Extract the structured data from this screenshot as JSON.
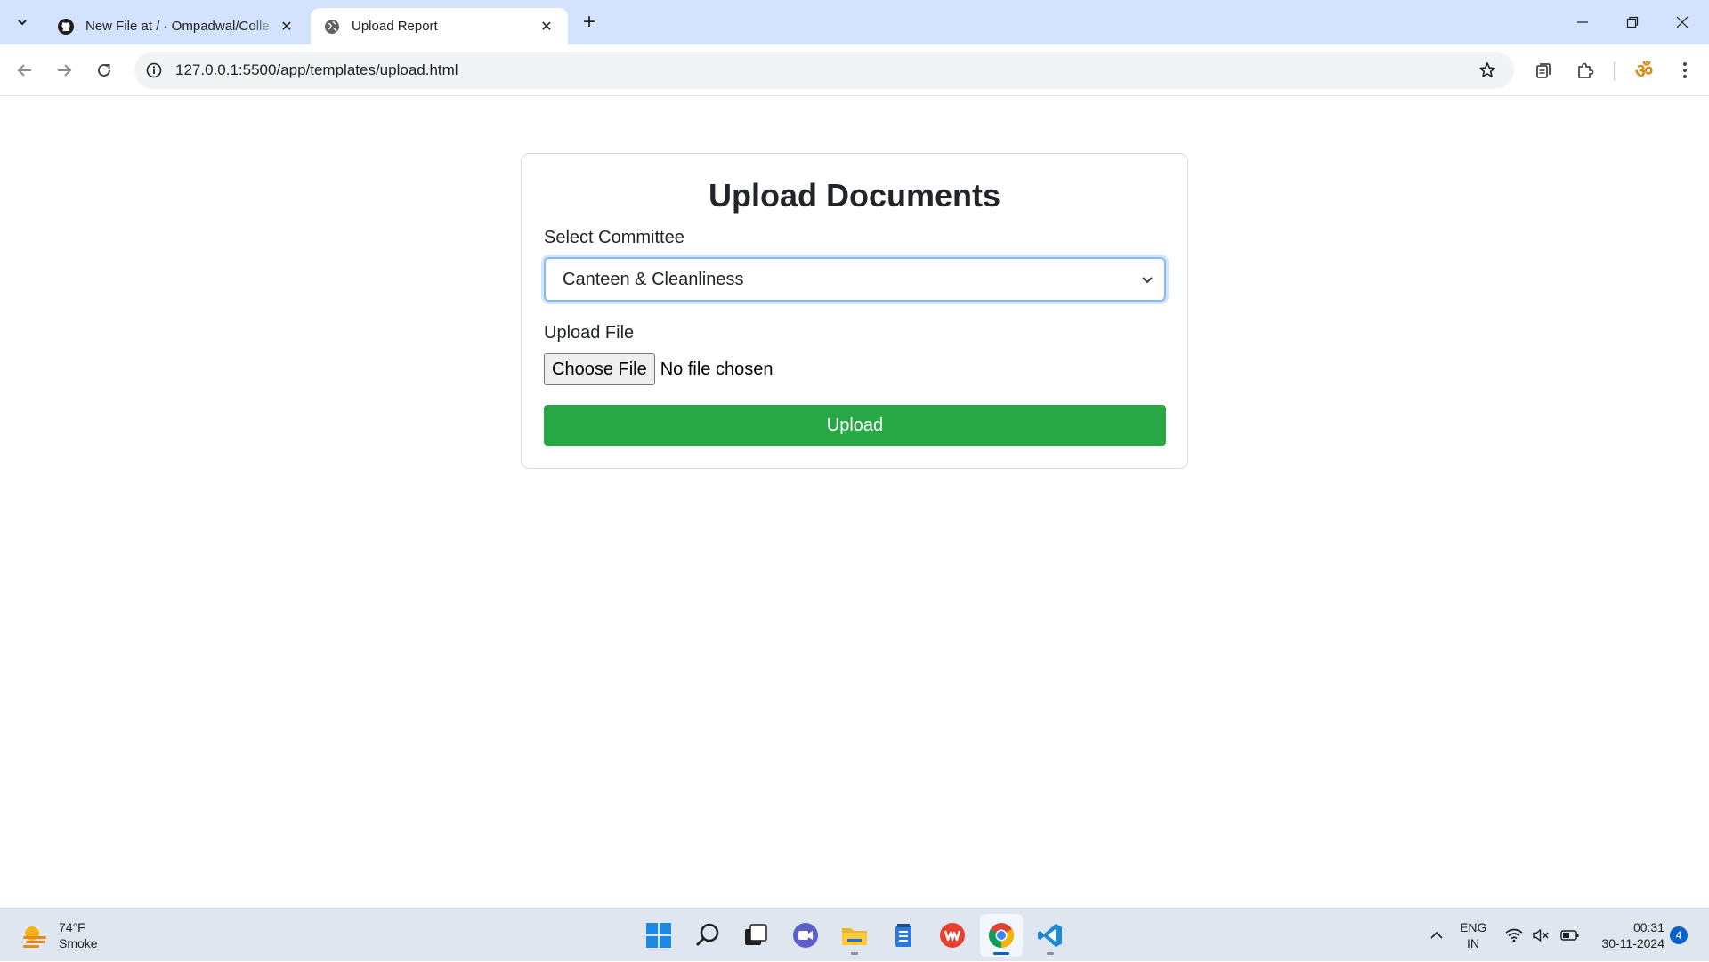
{
  "browser": {
    "tabs": [
      {
        "title": "New File at / · Ompadwal/Colle",
        "icon": "github-icon",
        "active": false
      },
      {
        "title": "Upload Report",
        "icon": "globe-icon",
        "active": true
      }
    ],
    "url": "127.0.0.1:5500/app/templates/upload.html",
    "accent": "#d3e3fd"
  },
  "page": {
    "title": "Upload Documents",
    "committee_label": "Select Committee",
    "committee_value": "Canteen & Cleanliness",
    "file_label": "Upload File",
    "choose_file": "Choose File",
    "file_status": "No file chosen",
    "upload_button": "Upload",
    "upload_color": "#28a745"
  },
  "taskbar": {
    "weather_temp": "74°F",
    "weather_desc": "Smoke",
    "lang_top": "ENG",
    "lang_bottom": "IN",
    "time": "00:31",
    "date": "30-11-2024",
    "notifications": "4",
    "apps": [
      "windows-start-icon",
      "search-icon",
      "task-view-icon",
      "meet-icon",
      "file-explorer-icon",
      "notepad-icon",
      "wps-office-icon",
      "chrome-icon",
      "vscode-icon"
    ]
  }
}
